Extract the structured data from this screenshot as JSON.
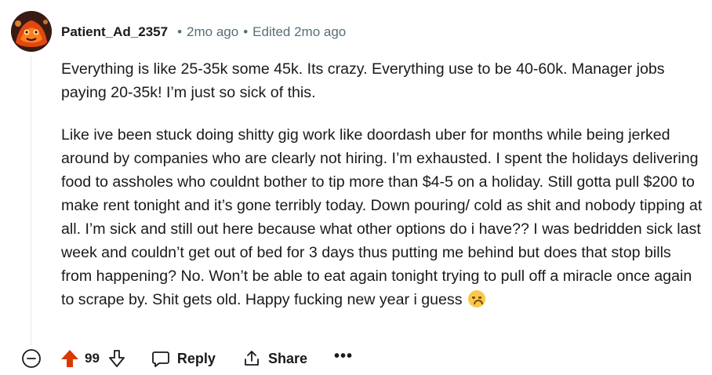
{
  "comment": {
    "username": "Patient_Ad_2357",
    "separator": "•",
    "time_ago": "2mo ago",
    "edited": "Edited 2mo ago",
    "paragraphs": [
      "Everything is like 25-35k some 45k. Its crazy. Everything use to be 40-60k. Manager jobs paying 20-35k! I’m just so sick of this.",
      "Like ive been stuck doing shitty gig work like doordash uber for months while being jerked around by companies who are clearly not hiring. I’m exhausted. I spent the holidays delivering food to assholes who couldnt bother to tip more than $4-5 on a holiday. Still gotta pull $200 to make rent tonight and it’s gone terribly today. Down pouring/ cold as shit and nobody tipping at all. I’m sick and still out here because what other options do i have?? I was bedridden sick last week and couldn’t get out of bed for 3 days thus putting me behind but does that stop bills from happening? No. Won’t be able to eat again tonight trying to pull off a miracle once again to scrape by. Shit gets old. Happy fucking new year i guess"
    ],
    "trailing_emoji": "disappointed-face-emoji"
  },
  "actions": {
    "vote_count": "99",
    "reply_label": "Reply",
    "share_label": "Share",
    "more_label": "•••"
  },
  "colors": {
    "upvote_active": "#d93a00",
    "muted_text": "#576f76",
    "text": "#1a1a1b"
  }
}
